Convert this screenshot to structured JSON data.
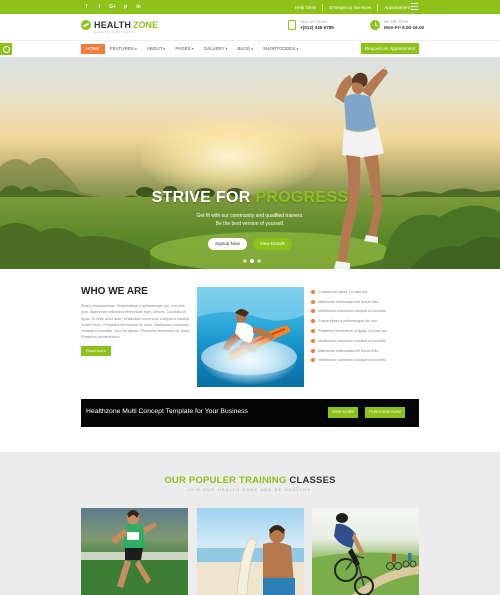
{
  "topbar": {
    "social_icons": [
      {
        "name": "facebook-icon",
        "glyph": "f"
      },
      {
        "name": "twitter-icon",
        "glyph": "t"
      },
      {
        "name": "google-plus-icon",
        "glyph": "G+"
      },
      {
        "name": "pinterest-icon",
        "glyph": "p"
      },
      {
        "name": "linkedin-icon",
        "glyph": "in"
      }
    ],
    "links": [
      "Help Desk",
      "Emergency Services",
      "Appointment"
    ]
  },
  "header": {
    "logo_part1": "HEALTH",
    "logo_part2": "ZONE",
    "logo_tagline": "HEALTH & FITNESS",
    "call_label": "CALL US TODAY",
    "call_value": "+(012) 345 6789",
    "hours_label": "WE ARE OPEN",
    "hours_value": "Mon-Fri 8.00-16.00"
  },
  "nav": {
    "items": [
      {
        "label": "HOME",
        "dropdown": false
      },
      {
        "label": "FEATURES",
        "dropdown": true
      },
      {
        "label": "ABOUT",
        "dropdown": true
      },
      {
        "label": "PAGES",
        "dropdown": true
      },
      {
        "label": "GALLERY",
        "dropdown": true
      },
      {
        "label": "BLOG",
        "dropdown": true
      },
      {
        "label": "SHORTCODES",
        "dropdown": true
      }
    ],
    "active_index": 0,
    "appointment_button": "Request an Appointment"
  },
  "hero": {
    "headline_part1": "STRIVE FOR",
    "headline_part2": "PROGRESS",
    "sub_line1": "Get fit with our community and qualified trainers.",
    "sub_line2": "Be the best version of yourself.",
    "button_primary": "Signup Now",
    "button_secondary": "View Details",
    "slides": 3,
    "active_slide": 2
  },
  "who": {
    "title": "WHO WE ARE",
    "paragraph": "Share voluptuousum. Suspendisse a pellentesque dui, non felis quis. Maecenas velit tellus fermentum eget, ultrices. Curabitur et ligula. Ut nisie dolor ante. Vestibulum commodo volutpat a suscipit. Ivoreet enim. Phasellus fermentum in, dolor. Vestibulum commodo volutpat a convallis. Sed vet aliquet. Phasellus fermentum in, dolor. Phasellus fermentum in.",
    "read_more": "Read more"
  },
  "checklist": [
    "Curabitur et ligula. Ut nisie dui.",
    "Maecenas malesuada elit lectus felis.",
    "Vestibulum commodo volutpat a convallis.",
    "Suspendisse a pellentesque dui non.",
    "Phasellus fermentum ut ligula. Ut nisie dui.",
    "Vestibulum commodo volutpat a convallis.",
    "Maecenas malesuada elit lectus felis.",
    "Vestibulum commodo volutpat a convallis."
  ],
  "banner": {
    "text": "Healthzone Multi Concept Template for Your Business",
    "button1": "VIEW MORE",
    "button2": "PURCHASE NOW"
  },
  "training": {
    "title_part1": "OUR POPULER TRAINING",
    "title_part2": "CLASSES",
    "tagline": "JOIN OUR HEALTH ZONE AND BE HEALTHY."
  },
  "colors": {
    "accent": "#8cc21a",
    "orange": "#f27c3a",
    "banner_bg": "#050505"
  }
}
